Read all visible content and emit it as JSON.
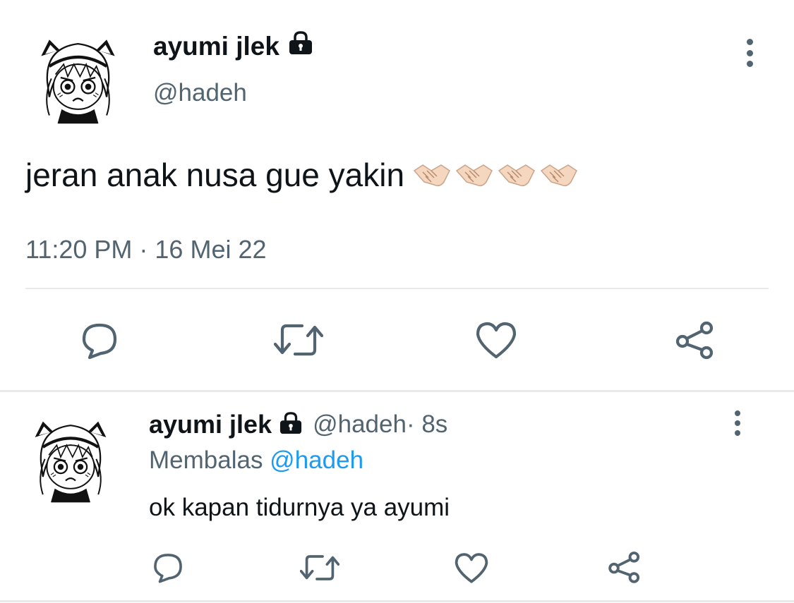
{
  "tweet": {
    "display_name": "ayumi jlek",
    "handle": "@hadeh",
    "text": "jeran anak nusa gue yakin",
    "emoji": "🤝🏻🤝🏻🤝🏻🤝🏻",
    "timestamp": "11:20 PM · 16 Mei 22",
    "icons": {
      "lock": "lock-icon",
      "more": "more-vertical-icon",
      "reply": "reply-icon",
      "retweet": "retweet-icon",
      "like": "like-icon",
      "share": "share-icon"
    }
  },
  "reply": {
    "display_name": "ayumi jlek",
    "handle": "@hadeh",
    "time": " · 8s",
    "replying_to_label": "Membalas ",
    "replying_to_handle": "@hadeh",
    "text": "ok kapan tidurnya ya ayumi"
  },
  "colors": {
    "text": "#0f1419",
    "secondary": "#536471",
    "accent": "#1d9bf0",
    "divider": "#e7e9ea"
  }
}
